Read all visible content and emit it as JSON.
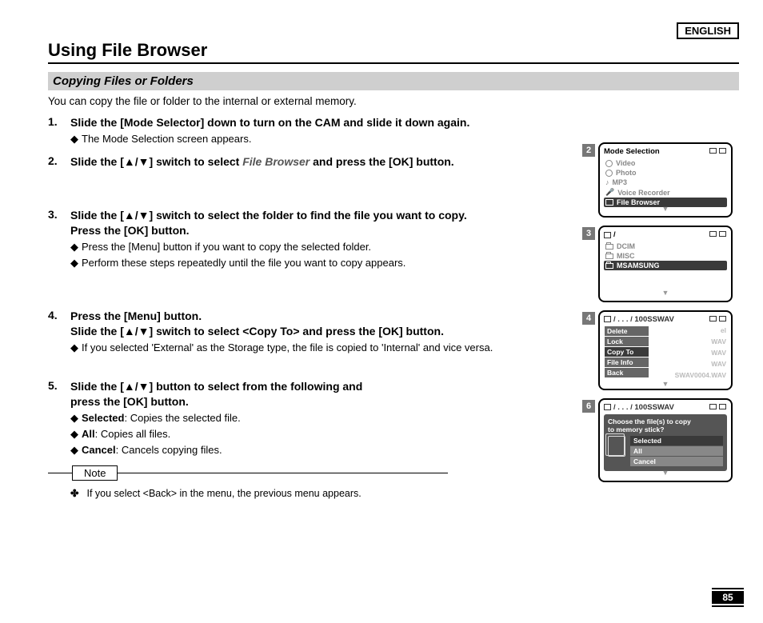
{
  "lang": "ENGLISH",
  "title": "Using File Browser",
  "subtitle": "Copying Files or Folders",
  "intro": "You can copy the file or folder to the internal or external memory.",
  "steps": {
    "s1": {
      "num": "1.",
      "head": "Slide the [Mode Selector] down to turn on the CAM and slide it down again.",
      "sub1": "The Mode Selection screen appears."
    },
    "s2": {
      "num": "2.",
      "head_a": "Slide the [",
      "head_b": "] switch to select ",
      "head_target": "File Browser",
      "head_c": " and press the [OK] button.",
      "arrows": "▲/▼"
    },
    "s3": {
      "num": "3.",
      "head_a": "Slide the [",
      "head_b": "] switch to select the folder to find the file you want to copy.",
      "head2": "Press the [OK] button.",
      "arrows": "▲/▼",
      "sub1": "Press the [Menu] button if you want to copy the selected folder.",
      "sub2": "Perform these steps repeatedly until the file you want to copy appears."
    },
    "s4": {
      "num": "4.",
      "head1": "Press the [Menu] button.",
      "head_a": "Slide the [",
      "head_b": "] switch to select <Copy To> and press the [OK] button.",
      "arrows": "▲/▼",
      "sub1": "If you selected 'External' as the Storage type, the file is copied to 'Internal' and vice versa."
    },
    "s5": {
      "num": "5.",
      "head_a": "Slide the [",
      "head_b": "] button to select from the following and",
      "head2": "press the [OK] button.",
      "arrows": "▲/▼",
      "opt1_b": "Selected",
      "opt1_t": ": Copies the selected file.",
      "opt2_b": "All",
      "opt2_t": ": Copies all files.",
      "opt3_b": "Cancel",
      "opt3_t": ": Cancels copying files."
    }
  },
  "note": {
    "label": "Note",
    "text": "If you select <Back> in the menu, the previous menu appears."
  },
  "page_num": "85",
  "screens": {
    "s2": {
      "badge": "2",
      "title": "Mode Selection",
      "items": [
        "Video",
        "Photo",
        "MP3",
        "Voice Recorder",
        "File Browser"
      ],
      "selected": 4
    },
    "s3": {
      "badge": "3",
      "path": "/",
      "folders": [
        "DCIM",
        "MISC",
        "MSAMSUNG"
      ],
      "selected": 2
    },
    "s4": {
      "badge": "4",
      "path": "/ . . . / 100SSWAV",
      "menu": [
        "Delete",
        "Lock",
        "Copy To",
        "File Info",
        "Back"
      ],
      "menu_sel": 2,
      "bg": [
        "el",
        "WAV",
        "WAV",
        "WAV",
        "SWAV0004.WAV"
      ]
    },
    "s6": {
      "badge": "6",
      "path": "/ . . . / 100SSWAV",
      "dialog_l1": "Choose the file(s) to copy",
      "dialog_l2": "to memory stick?",
      "options": [
        "Selected",
        "All",
        "Cancel"
      ],
      "opt_sel": 0
    }
  }
}
